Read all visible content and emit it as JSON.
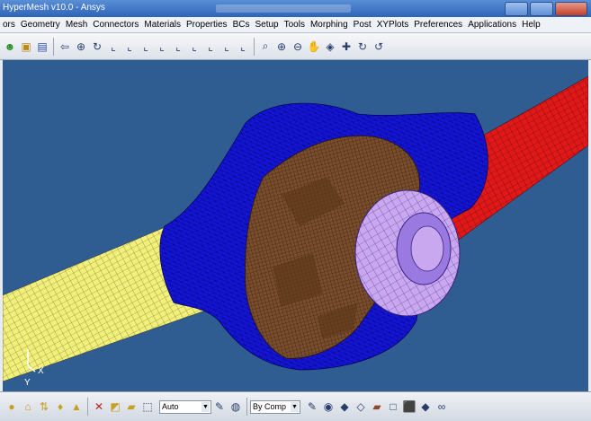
{
  "window": {
    "title": "HyperMesh v10.0 - Ansys"
  },
  "menu": [
    "ors",
    "Geometry",
    "Mesh",
    "Connectors",
    "Materials",
    "Properties",
    "BCs",
    "Setup",
    "Tools",
    "Morphing",
    "Post",
    "XYPlots",
    "Preferences",
    "Applications",
    "Help"
  ],
  "toolbar_icons": [
    {
      "name": "user-icon",
      "glyph": "☻",
      "color": "#2f8f2f"
    },
    {
      "name": "open-icon",
      "glyph": "▣",
      "color": "#b88a1a"
    },
    {
      "name": "save-icon",
      "glyph": "▤",
      "color": "#2a4f9f"
    },
    {
      "name": "sep"
    },
    {
      "name": "back-arrow-icon",
      "glyph": "⇦",
      "color": "#2a3d6a"
    },
    {
      "name": "zoom-icon",
      "glyph": "⊕",
      "color": "#2a3d6a"
    },
    {
      "name": "rotate-icon",
      "glyph": "↻",
      "color": "#2a3d6a"
    },
    {
      "name": "view-x-icon",
      "glyph": "⌞",
      "color": "#2a3d6a"
    },
    {
      "name": "view-x2-icon",
      "glyph": "⌞",
      "color": "#2a3d6a"
    },
    {
      "name": "view-y-icon",
      "glyph": "⌞",
      "color": "#2a3d6a"
    },
    {
      "name": "view-y2-icon",
      "glyph": "⌞",
      "color": "#2a3d6a"
    },
    {
      "name": "view-z-icon",
      "glyph": "⌞",
      "color": "#2a3d6a"
    },
    {
      "name": "view-z2-icon",
      "glyph": "⌞",
      "color": "#2a3d6a"
    },
    {
      "name": "view-iso-icon",
      "glyph": "⌞",
      "color": "#2a3d6a"
    },
    {
      "name": "view-iso2-icon",
      "glyph": "⌞",
      "color": "#2a3d6a"
    },
    {
      "name": "view-free-icon",
      "glyph": "⌞",
      "color": "#2a3d6a"
    },
    {
      "name": "sep"
    },
    {
      "name": "zoom-window-icon",
      "glyph": "⌕",
      "color": "#2a3d6a"
    },
    {
      "name": "zoom-in-icon",
      "glyph": "⊕",
      "color": "#2a3d6a"
    },
    {
      "name": "zoom-out-icon",
      "glyph": "⊖",
      "color": "#2a3d6a"
    },
    {
      "name": "pan-hand-icon",
      "glyph": "✋",
      "color": "#2a3d6a"
    },
    {
      "name": "fit-icon",
      "glyph": "◈",
      "color": "#2a3d6a"
    },
    {
      "name": "center-icon",
      "glyph": "✚",
      "color": "#2a3d6a"
    },
    {
      "name": "rotate-view-icon",
      "glyph": "↻",
      "color": "#2a3d6a"
    },
    {
      "name": "spin-icon",
      "glyph": "↺",
      "color": "#2a3d6a"
    }
  ],
  "statusbar": {
    "icons_left": [
      {
        "name": "component-icon",
        "glyph": "●",
        "color": "#c8a020"
      },
      {
        "name": "lock-icon",
        "glyph": "⌂",
        "color": "#c8a020"
      },
      {
        "name": "shuffle-icon",
        "glyph": "⇅",
        "color": "#c8a020"
      },
      {
        "name": "pin-icon",
        "glyph": "♦",
        "color": "#c8a020"
      },
      {
        "name": "tag-icon",
        "glyph": "▲",
        "color": "#c8a020"
      },
      {
        "name": "sep"
      },
      {
        "name": "delete-icon",
        "glyph": "✕",
        "color": "#c02020"
      },
      {
        "name": "shapes-icon",
        "glyph": "◩",
        "color": "#c8a020"
      },
      {
        "name": "folder-icon",
        "glyph": "▰",
        "color": "#c8a020"
      },
      {
        "name": "dotted-box-icon",
        "glyph": "⬚",
        "color": "#2a3d6a"
      }
    ],
    "auto_dropdown": "Auto",
    "bycomp_dropdown": "By Comp",
    "icons_right": [
      {
        "name": "pen-icon",
        "glyph": "✎",
        "color": "#2a3d6a"
      },
      {
        "name": "color-icon",
        "glyph": "◉",
        "color": "#2a3d6a"
      },
      {
        "name": "shaded-cube-icon",
        "glyph": "◆",
        "color": "#2a3d6a"
      },
      {
        "name": "wire-cube-icon",
        "glyph": "◇",
        "color": "#2a3d6a"
      },
      {
        "name": "brick-icon",
        "glyph": "▰",
        "color": "#8b4a2a"
      },
      {
        "name": "box-icon",
        "glyph": "□",
        "color": "#2a3d6a"
      },
      {
        "name": "cube-icon",
        "glyph": "⬛",
        "color": "#2a3d6a"
      },
      {
        "name": "mesh-cube-icon",
        "glyph": "◆",
        "color": "#2a3d6a"
      },
      {
        "name": "glasses-icon",
        "glyph": "∞",
        "color": "#2a3d6a"
      }
    ]
  },
  "axis": {
    "x": "X",
    "y": "Y"
  },
  "colors": {
    "viewport_bg": "#2f5d92",
    "housing": "#1515d8",
    "shaft_left": "#f2f07a",
    "shaft_right": "#e01818",
    "carrier": "#6b4426",
    "flange": "#c9a8f0"
  }
}
